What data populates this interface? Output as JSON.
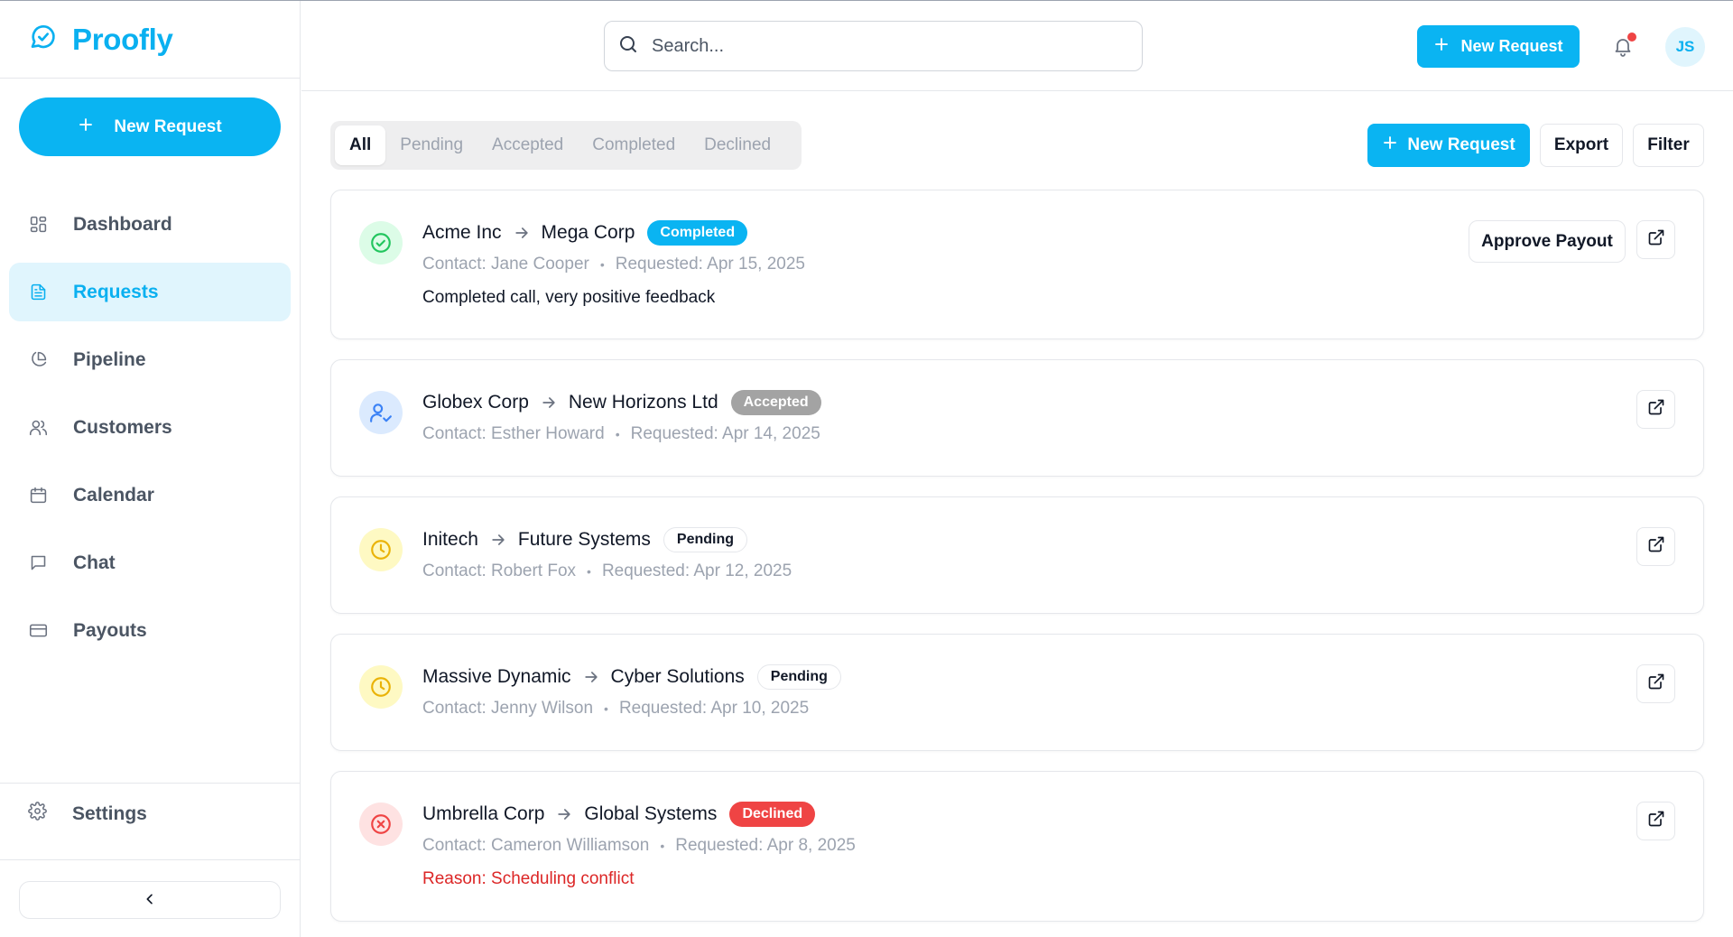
{
  "brand": {
    "name": "Proofly"
  },
  "sidebar": {
    "new_request_label": "New Request",
    "items": [
      {
        "label": "Dashboard",
        "icon": "dashboard-icon",
        "active": false
      },
      {
        "label": "Requests",
        "icon": "file-text-icon",
        "active": true
      },
      {
        "label": "Pipeline",
        "icon": "pie-chart-icon",
        "active": false
      },
      {
        "label": "Customers",
        "icon": "users-icon",
        "active": false
      },
      {
        "label": "Calendar",
        "icon": "calendar-icon",
        "active": false
      },
      {
        "label": "Chat",
        "icon": "message-icon",
        "active": false
      },
      {
        "label": "Payouts",
        "icon": "credit-card-icon",
        "active": false
      }
    ],
    "settings_label": "Settings",
    "collapse_icon": "chevron-left-icon"
  },
  "topbar": {
    "search_placeholder": "Search...",
    "new_request_label": "New Request",
    "avatar_initials": "JS"
  },
  "toolbar": {
    "tabs": [
      "All",
      "Pending",
      "Accepted",
      "Completed",
      "Declined"
    ],
    "active_tab": "All",
    "new_request_label": "New Request",
    "export_label": "Export",
    "filter_label": "Filter"
  },
  "requests": [
    {
      "from": "Acme Inc",
      "to": "Mega Corp",
      "status": "Completed",
      "contact": "Contact: Jane Cooper",
      "requested": "Requested: Apr 15, 2025",
      "note": "Completed call, very positive feedback",
      "action_label": "Approve Payout"
    },
    {
      "from": "Globex Corp",
      "to": "New Horizons Ltd",
      "status": "Accepted",
      "contact": "Contact: Esther Howard",
      "requested": "Requested: Apr 14, 2025"
    },
    {
      "from": "Initech",
      "to": "Future Systems",
      "status": "Pending",
      "contact": "Contact: Robert Fox",
      "requested": "Requested: Apr 12, 2025"
    },
    {
      "from": "Massive Dynamic",
      "to": "Cyber Solutions",
      "status": "Pending",
      "contact": "Contact: Jenny Wilson",
      "requested": "Requested: Apr 10, 2025"
    },
    {
      "from": "Umbrella Corp",
      "to": "Global Systems",
      "status": "Declined",
      "contact": "Contact: Cameron Williamson",
      "requested": "Requested: Apr 8, 2025",
      "note": "Reason: Scheduling conflict"
    }
  ],
  "colors": {
    "accent": "#0ab4f2",
    "completed": "#0ab4f2",
    "accepted": "#a3a3a3",
    "declined": "#ef4444",
    "pending_icon": "#eab308",
    "completed_icon": "#22c55e"
  }
}
